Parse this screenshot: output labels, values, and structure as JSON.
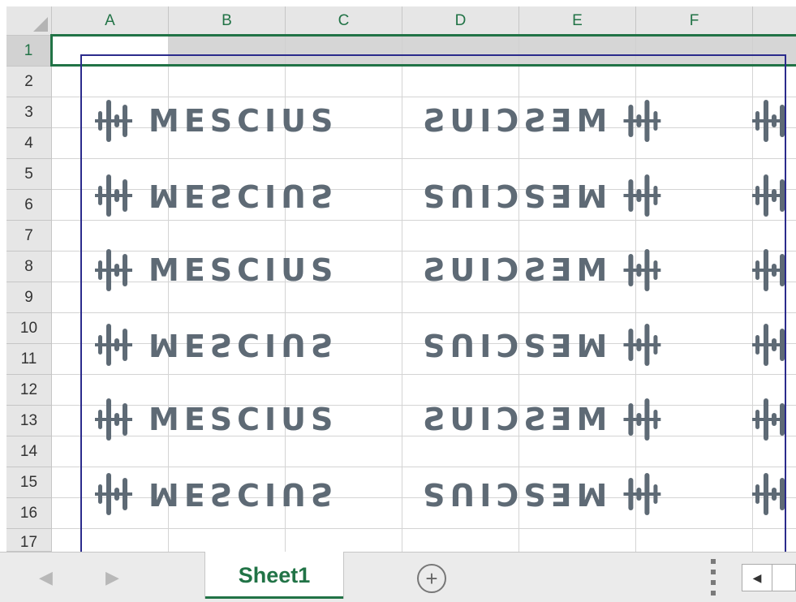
{
  "columns": [
    "A",
    "B",
    "C",
    "D",
    "E",
    "F"
  ],
  "rows": [
    "1",
    "2",
    "3",
    "4",
    "5",
    "6",
    "7",
    "8",
    "9",
    "10",
    "11",
    "12",
    "13",
    "14",
    "15",
    "16",
    "17"
  ],
  "selected_cell_row": "1",
  "picture": {
    "logo_text": "MESCIUS",
    "repeat_rows": 6
  },
  "tabs": {
    "sheet_name": "Sheet1",
    "prev_arrow": "◀",
    "next_arrow": "▶",
    "add_sheet": "+",
    "scroll_left": "◀"
  },
  "colors": {
    "accent": "#217346",
    "logo": "#5e6a75",
    "picture_border": "#2b2b8c"
  }
}
